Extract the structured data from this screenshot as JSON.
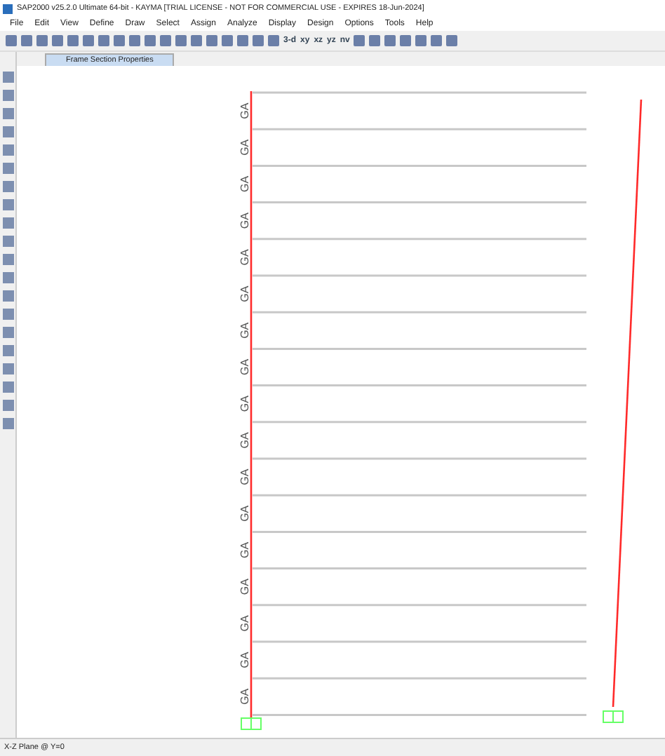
{
  "window": {
    "title": "SAP2000 v25.2.0 Ultimate 64-bit - KAYMA  [TRIAL LICENSE - NOT FOR COMMERCIAL USE - EXPIRES 18-Jun-2024]"
  },
  "menu": [
    "File",
    "Edit",
    "View",
    "Define",
    "Draw",
    "Select",
    "Assign",
    "Analyze",
    "Display",
    "Design",
    "Options",
    "Tools",
    "Help"
  ],
  "toolbar_text": [
    "3-d",
    "xy",
    "xz",
    "yz",
    "nv"
  ],
  "tabs": [
    {
      "label": "Frame Section Properties",
      "selected": true
    }
  ],
  "frame_labels": [
    "GA",
    "GA",
    "GA",
    "GA",
    "GA",
    "GA",
    "GA",
    "GA",
    "GA",
    "GA",
    "GA",
    "GA",
    "GA",
    "GA",
    "GA",
    "GA",
    "GA"
  ],
  "status_bar": "X-Z Plane @ Y=0"
}
